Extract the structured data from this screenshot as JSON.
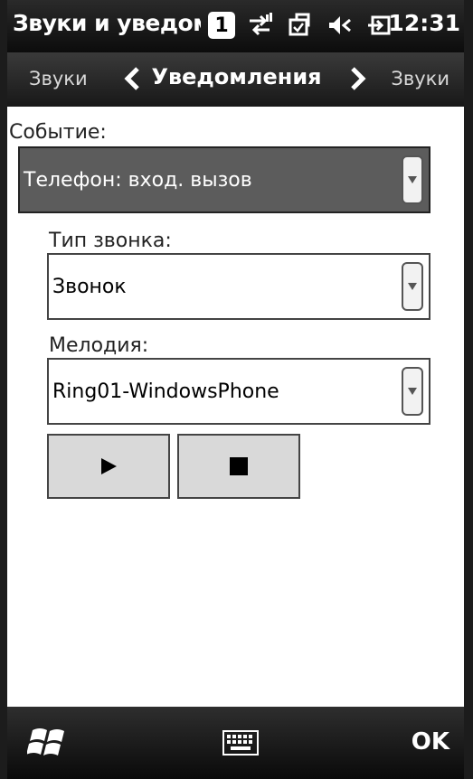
{
  "status_bar": {
    "title": "Звуки и уведомления",
    "badge": "1",
    "icons": [
      "connectivity-icon",
      "sync-icon",
      "volume-icon",
      "battery-icon"
    ],
    "time": "12:31"
  },
  "tabs": {
    "prev_label": "Звуки",
    "current_label": "Уведомления",
    "next_label": "Звуки"
  },
  "form": {
    "event_label": "Событие:",
    "event_value": "Телефон: вход. вызов",
    "ring_type_label": "Тип звонка:",
    "ring_type_value": "Звонок",
    "melody_label": "Мелодия:",
    "melody_value": "Ring01-WindowsPhone"
  },
  "buttons": {
    "play_icon": "play-icon",
    "stop_icon": "stop-icon"
  },
  "bottom_bar": {
    "start_icon": "windows-logo-icon",
    "keyboard_icon": "keyboard-icon",
    "ok_label": "OK"
  }
}
